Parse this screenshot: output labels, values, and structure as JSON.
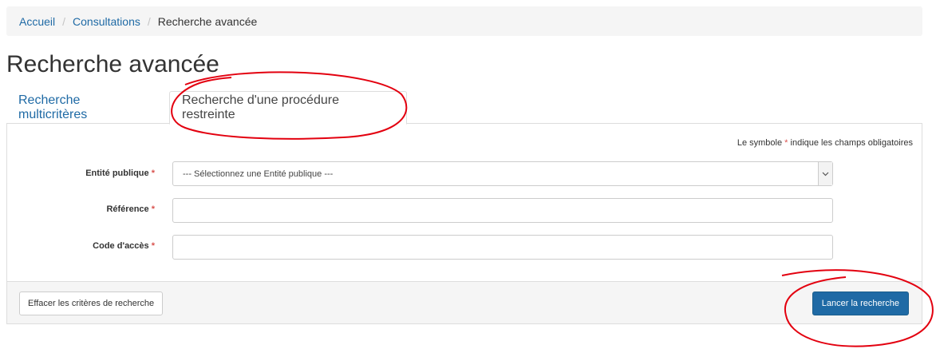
{
  "breadcrumb": {
    "items": [
      "Accueil",
      "Consultations"
    ],
    "separator": "/",
    "current": "Recherche avancée"
  },
  "page_title": "Recherche avancée",
  "tabs": [
    {
      "label": "Recherche multicritères",
      "active": false
    },
    {
      "label": "Recherche d'une procédure restreinte",
      "active": true
    }
  ],
  "form": {
    "mandatory_note_prefix": "Le symbole",
    "mandatory_note_suffix": "indique les champs obligatoires",
    "required_marker": "*",
    "fields": [
      {
        "label": "Entité publique",
        "type": "select",
        "value": "--- Sélectionnez une Entité publique ---"
      },
      {
        "label": "Référence",
        "type": "text",
        "value": ""
      },
      {
        "label": "Code d'accès",
        "type": "text",
        "value": ""
      }
    ]
  },
  "actions": {
    "clear_label": "Effacer les critères de recherche",
    "submit_label": "Lancer la recherche"
  },
  "colors": {
    "link": "#1f6aa5",
    "primary": "#1f6aa5",
    "required": "#d9534f",
    "annotation": "#e3000f"
  },
  "icons": {
    "select_caret": "chevron-down-icon"
  }
}
